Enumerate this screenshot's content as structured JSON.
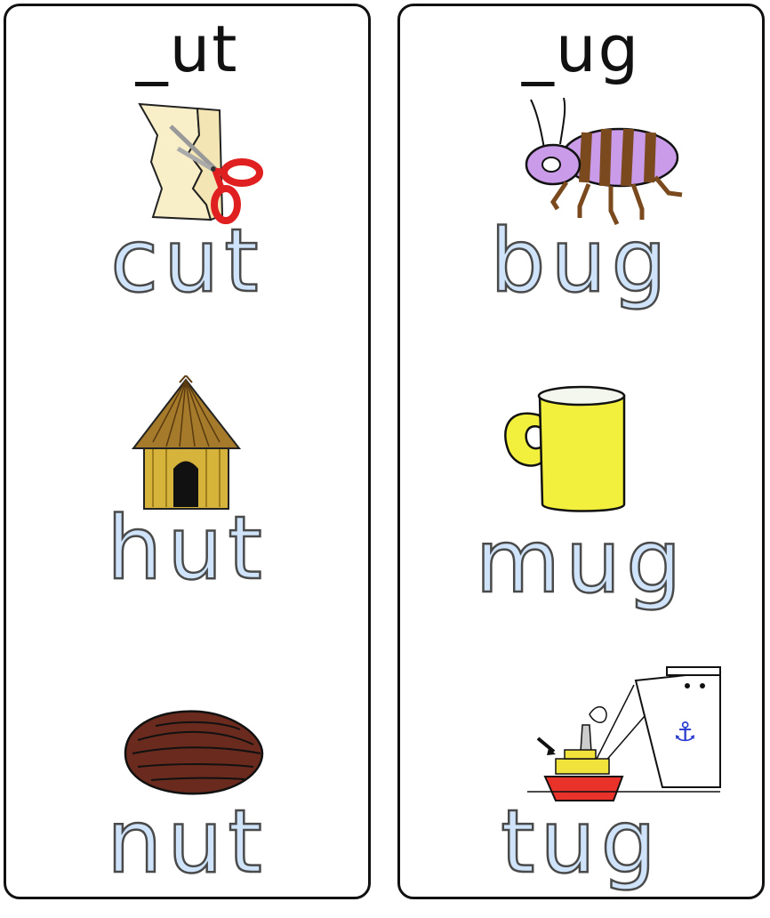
{
  "columns": [
    {
      "heading": "_ut",
      "words": [
        {
          "text": "cut",
          "icon": "scissors-cutting-paper-icon"
        },
        {
          "text": "hut",
          "icon": "thatched-hut-icon"
        },
        {
          "text": "nut",
          "icon": "nut-icon"
        }
      ]
    },
    {
      "heading": "_ug",
      "words": [
        {
          "text": "bug",
          "icon": "bug-icon"
        },
        {
          "text": "mug",
          "icon": "mug-icon"
        },
        {
          "text": "tug",
          "icon": "tugboat-icon"
        }
      ]
    }
  ],
  "colors": {
    "word_fill": "#cfe4fa",
    "word_outline": "#4a4a4a",
    "border": "#111111",
    "bug_body": "#c99be8",
    "bug_stripes": "#7a4a1e",
    "mug": "#f2f03c",
    "hut": "#d6b33a",
    "nut": "#6b2a1e",
    "scissors": "#e02020",
    "tugboat_hull": "#e8322a"
  }
}
